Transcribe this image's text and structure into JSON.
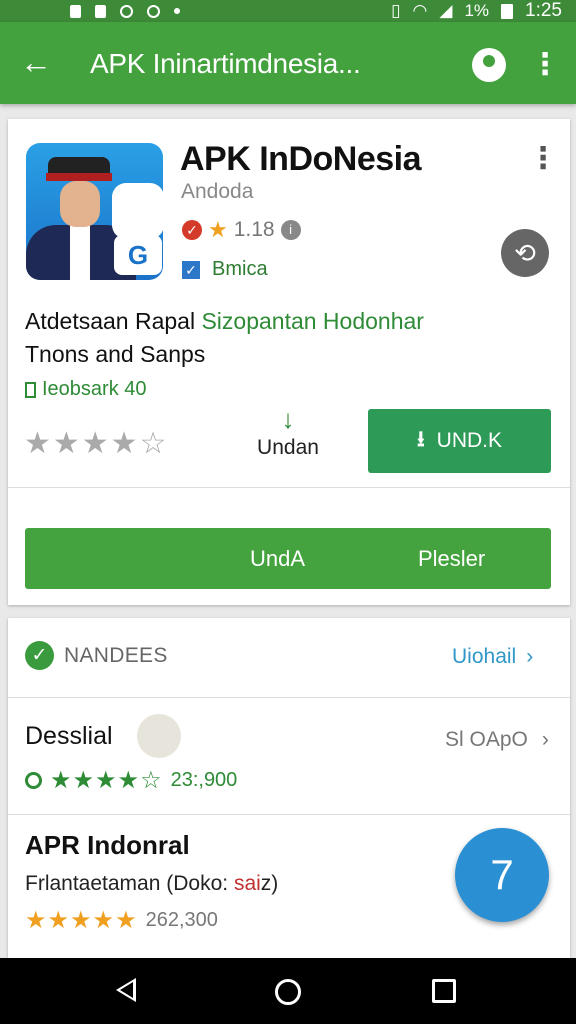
{
  "status_bar": {
    "battery": "1%",
    "time": "1:25"
  },
  "app_bar": {
    "title": "APK Ininartimdnesia...",
    "back_icon": "arrow-left-icon",
    "account_icon": "account-icon",
    "more_icon": "more-vert-icon",
    "color": "#43a13e"
  },
  "app": {
    "title": "APK InDoNesia",
    "developer": "Andoda",
    "rating": "1.18",
    "badge_label": "Bmica",
    "description_line1_black": "Atdetsaan Rapal ",
    "description_line1_green": "Sizopantan Hodonhar",
    "description_line2": "Tnons and Sanps",
    "downloads": "Ieobsark 40",
    "secondary_action_label": "Undan",
    "install_label": "UND.K",
    "big_button_left": "UndA",
    "big_button_right": "Plesler",
    "accent_green": "#2e9a58"
  },
  "section": {
    "header": "NANDEES",
    "link": "Uiohail",
    "items": [
      {
        "name": "Desslial",
        "meta": "Sl OApO",
        "reviews": "23:,900"
      },
      {
        "name": "APR Indonral",
        "subtitle": "Frlantaetaman (Doko: ",
        "subtitle_red": "sai",
        "subtitle_end": "z)",
        "reviews": "262,300"
      }
    ]
  },
  "fab": {
    "label": "7",
    "color": "#2b8fd3"
  }
}
